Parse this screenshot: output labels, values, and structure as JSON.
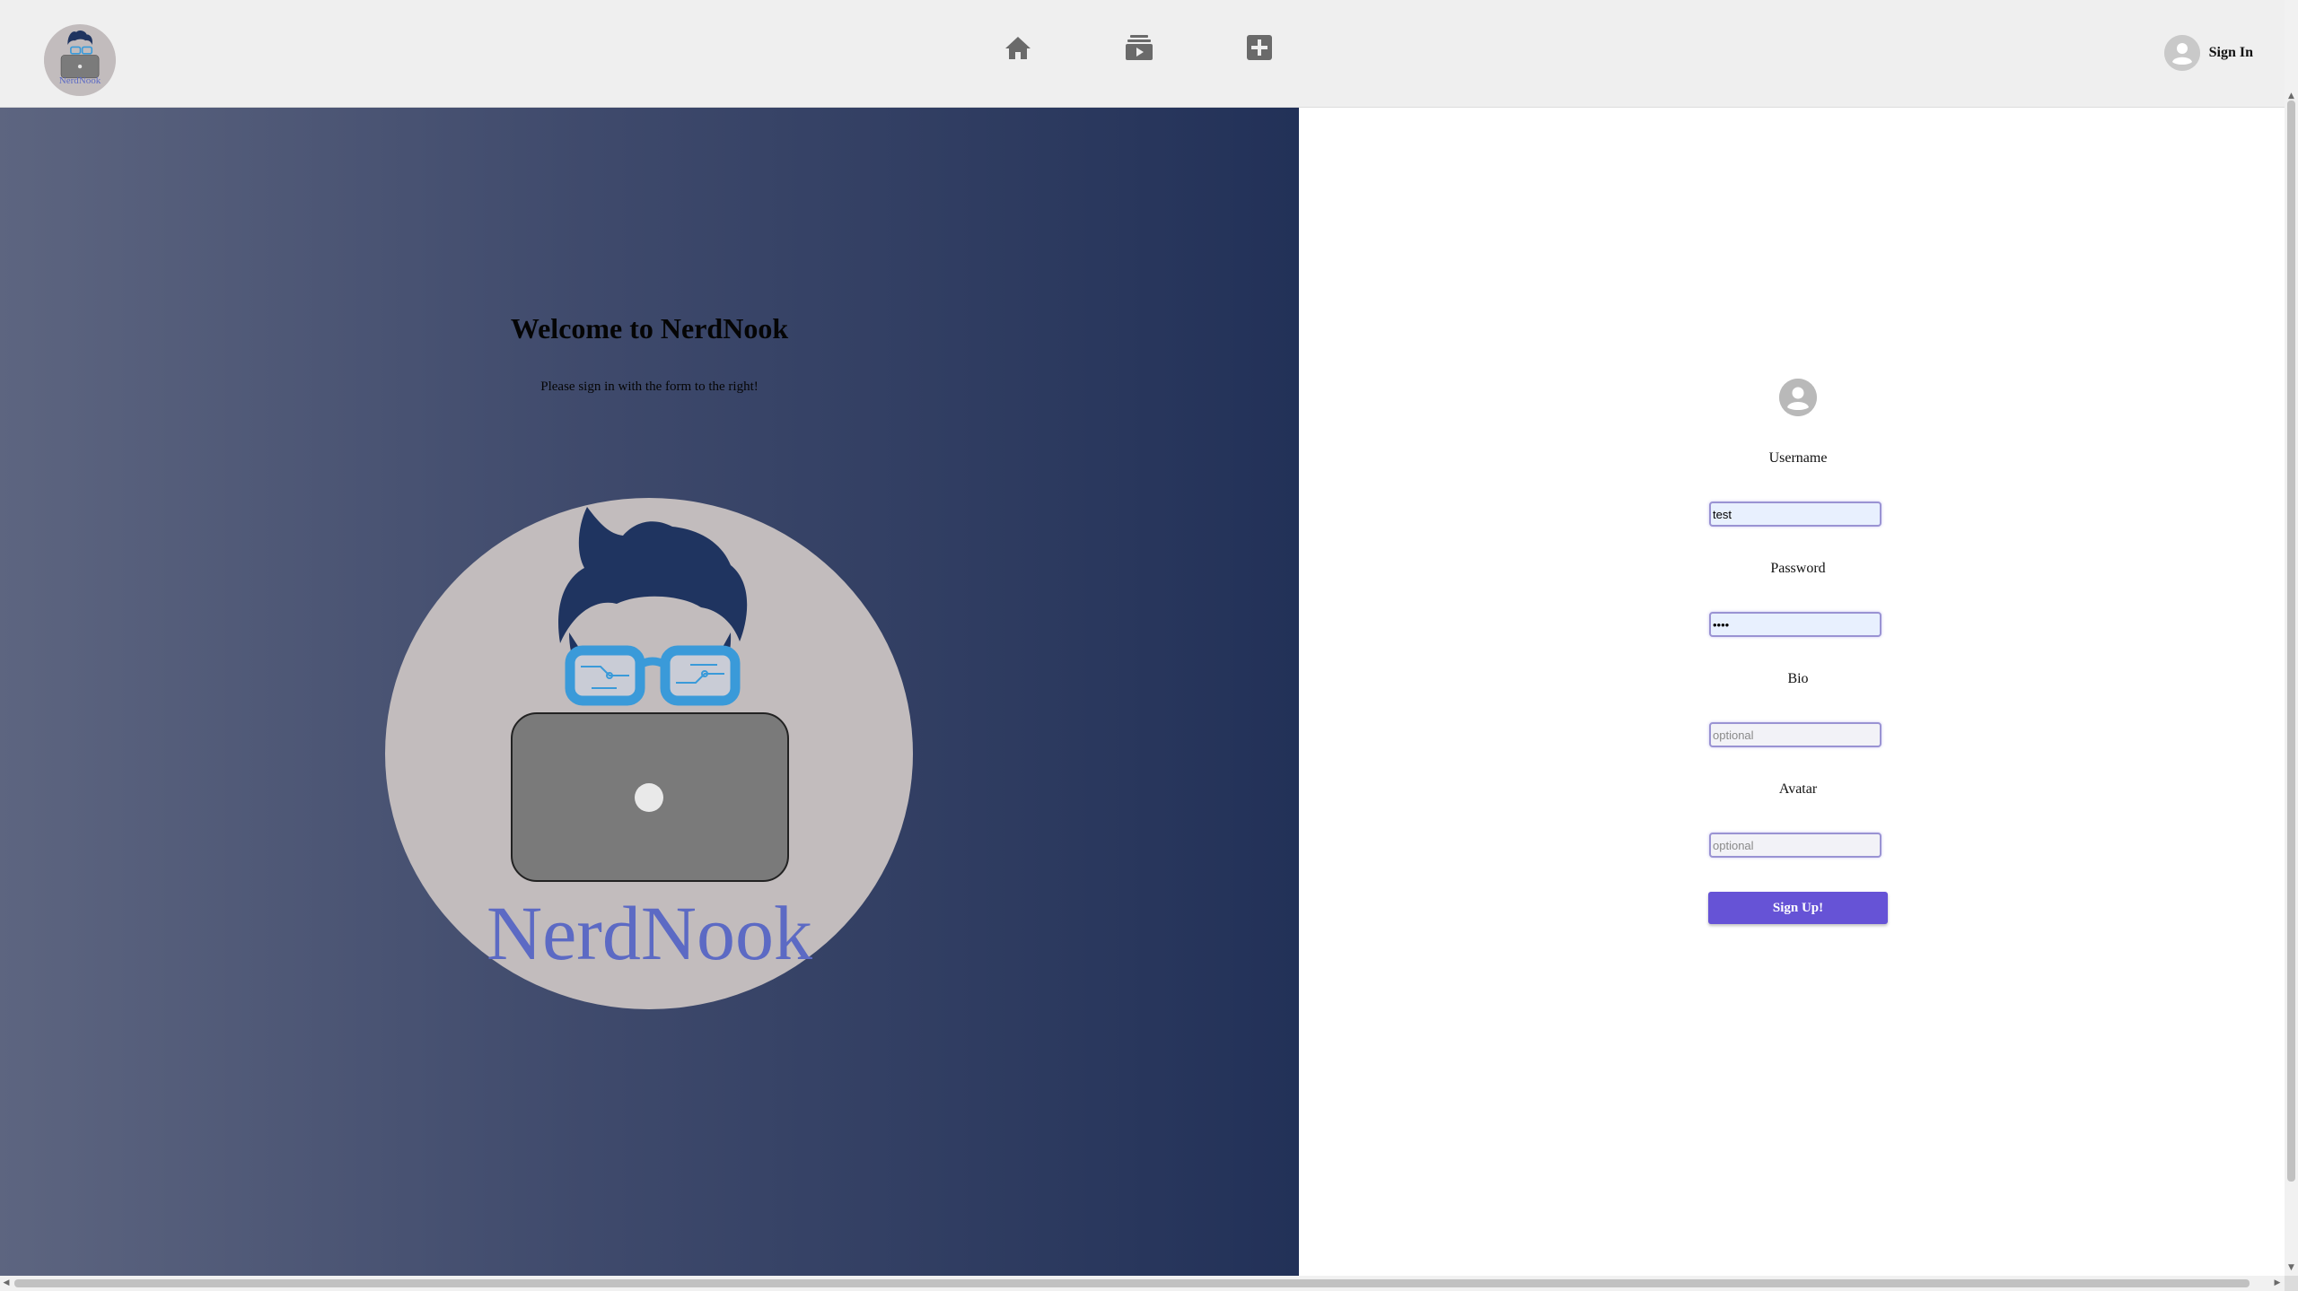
{
  "header": {
    "logo_text": "NerdNook",
    "nav": [
      {
        "icon": "home-icon"
      },
      {
        "icon": "video-feed-icon"
      },
      {
        "icon": "add-post-icon"
      }
    ],
    "signin_label": "Sign In",
    "signin_icon": "user-avatar-icon"
  },
  "hero": {
    "title": "Welcome to NerdNook",
    "subtitle": "Please sign in with the form to the right!",
    "logo_text": "NerdNook",
    "gradient": [
      "#5d6580",
      "#223158"
    ]
  },
  "form": {
    "icon": "user-avatar-icon",
    "fields": [
      {
        "label": "Username",
        "value": "test",
        "placeholder": ""
      },
      {
        "label": "Password",
        "value": "test",
        "placeholder": ""
      },
      {
        "label": "Bio",
        "value": "",
        "placeholder": "optional"
      },
      {
        "label": "Avatar",
        "value": "",
        "placeholder": "optional"
      }
    ],
    "submit_label": "Sign Up!"
  },
  "colors": {
    "accent": "#6653d6",
    "header_bg": "#efefef",
    "logo_bg": "#c2bcbd",
    "logo_text": "#5c6ac4",
    "hair": "#1f3460",
    "glasses": "#3a9ad9"
  }
}
